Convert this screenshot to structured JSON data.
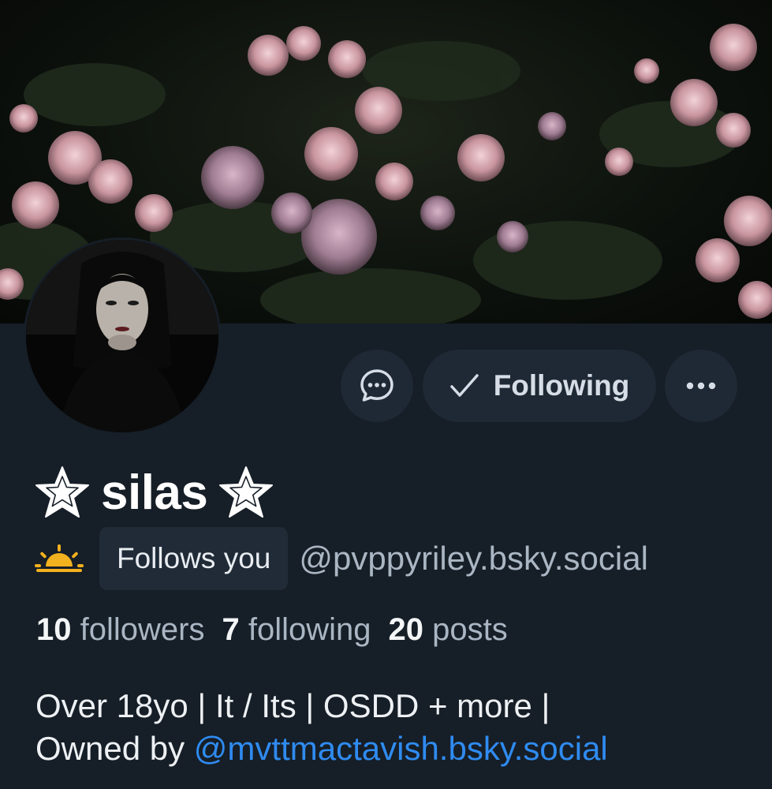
{
  "profile": {
    "display_name": "silas",
    "name_icon": "star-outline-icon",
    "status_emoji_icon": "sunrise-icon",
    "follows_you_label": "Follows you",
    "handle": "@pvppyriley.bsky.social",
    "stats": {
      "followers_count": "10",
      "followers_label": "followers",
      "following_count": "7",
      "following_label": "following",
      "posts_count": "20",
      "posts_label": "posts"
    },
    "bio": {
      "line1": "Over 18yo | It / Its | OSDD + more |",
      "line2_prefix": "Owned by ",
      "line2_mention": "@mvttmactavish.bsky.social"
    }
  },
  "actions": {
    "message_icon": "chat-bubble-icon",
    "following_check_icon": "check-icon",
    "following_label": "Following",
    "more_icon": "ellipsis-icon"
  },
  "colors": {
    "background": "#161e27",
    "button_bg": "#1e2935",
    "badge_bg": "#202b37",
    "mention": "#2f8bf0",
    "muted_text": "#aab6c3"
  }
}
